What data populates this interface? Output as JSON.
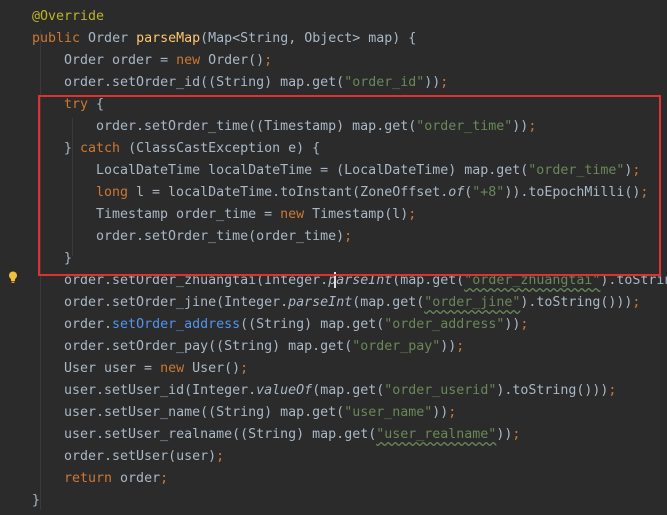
{
  "code_lines": [
    {
      "indent": 0,
      "tokens": [
        {
          "t": "@Override",
          "c": "ann"
        }
      ]
    },
    {
      "indent": 0,
      "tokens": [
        {
          "t": "public ",
          "c": "kw"
        },
        {
          "t": "Order "
        },
        {
          "t": "parseMap",
          "c": "fn"
        },
        {
          "t": "(Map<String, Object> map) {"
        }
      ]
    },
    {
      "indent": 1,
      "tokens": [
        {
          "t": "Order order = "
        },
        {
          "t": "new ",
          "c": "kw"
        },
        {
          "t": "Order()"
        },
        {
          "t": ";",
          "c": "kw"
        }
      ]
    },
    {
      "indent": 1,
      "tokens": [
        {
          "t": "order.setOrder_id((String) map.get("
        },
        {
          "t": "\"order_id\"",
          "c": "str"
        },
        {
          "t": "))"
        },
        {
          "t": ";",
          "c": "kw"
        }
      ]
    },
    {
      "indent": 1,
      "tokens": [
        {
          "t": "try ",
          "c": "kw"
        },
        {
          "t": "{"
        }
      ]
    },
    {
      "indent": 2,
      "tokens": [
        {
          "t": "order.setOrder_time((Timestamp) map.get("
        },
        {
          "t": "\"order_time\"",
          "c": "str"
        },
        {
          "t": "))"
        },
        {
          "t": ";",
          "c": "kw"
        }
      ]
    },
    {
      "indent": 1,
      "tokens": [
        {
          "t": "} "
        },
        {
          "t": "catch ",
          "c": "kw"
        },
        {
          "t": "(ClassCastException e) {"
        }
      ]
    },
    {
      "indent": 2,
      "tokens": [
        {
          "t": "LocalDateTime localDateTime = (LocalDateTime) map.get("
        },
        {
          "t": "\"order_time\"",
          "c": "str"
        },
        {
          "t": ")"
        },
        {
          "t": ";",
          "c": "kw"
        }
      ]
    },
    {
      "indent": 2,
      "tokens": [
        {
          "t": "long ",
          "c": "kw"
        },
        {
          "t": "l = localDateTime.toInstant(ZoneOffset."
        },
        {
          "t": "of",
          "c": "it"
        },
        {
          "t": "("
        },
        {
          "t": "\"+8\"",
          "c": "str"
        },
        {
          "t": ")).toEpochMilli()"
        },
        {
          "t": ";",
          "c": "kw"
        }
      ]
    },
    {
      "indent": 2,
      "tokens": [
        {
          "t": "Timestamp order_time = "
        },
        {
          "t": "new ",
          "c": "kw"
        },
        {
          "t": "Timestamp(l)"
        },
        {
          "t": ";",
          "c": "kw"
        }
      ]
    },
    {
      "indent": 2,
      "tokens": [
        {
          "t": "order.setOrder_time(order_time)"
        },
        {
          "t": ";",
          "c": "kw"
        }
      ]
    },
    {
      "indent": 1,
      "tokens": [
        {
          "t": "}"
        }
      ]
    },
    {
      "indent": 1,
      "tokens": [
        {
          "t": "order.setOrder_zhuangtai(Integer."
        },
        {
          "t": "parseInt",
          "c": "it"
        },
        {
          "t": "(map.get("
        },
        {
          "t": "\"order_zhuangtai\"",
          "c": "str squig"
        },
        {
          "t": ").toString()))"
        },
        {
          "t": ";",
          "c": "kw"
        }
      ]
    },
    {
      "indent": 1,
      "tokens": [
        {
          "t": "order.setOrder_jine(Integer."
        },
        {
          "t": "parseInt",
          "c": "it"
        },
        {
          "t": "(map.get("
        },
        {
          "t": "\"order_jine\"",
          "c": "str squig"
        },
        {
          "t": ").toString()))"
        },
        {
          "t": ";",
          "c": "kw"
        }
      ]
    },
    {
      "indent": 1,
      "tokens": [
        {
          "t": "order."
        },
        {
          "t": "setOrder_address",
          "c": "blu"
        },
        {
          "t": "((String) map.get("
        },
        {
          "t": "\"order_address\"",
          "c": "str"
        },
        {
          "t": "))"
        },
        {
          "t": ";",
          "c": "kw"
        }
      ]
    },
    {
      "indent": 1,
      "tokens": [
        {
          "t": "order.setOrder_pay((String) map.get("
        },
        {
          "t": "\"order_pay\"",
          "c": "str"
        },
        {
          "t": "))"
        },
        {
          "t": ";",
          "c": "kw"
        }
      ]
    },
    {
      "indent": 1,
      "tokens": [
        {
          "t": "User user = "
        },
        {
          "t": "new ",
          "c": "kw"
        },
        {
          "t": "User()"
        },
        {
          "t": ";",
          "c": "kw"
        }
      ]
    },
    {
      "indent": 1,
      "tokens": [
        {
          "t": "user.setUser_id(Integer."
        },
        {
          "t": "valueOf",
          "c": "it"
        },
        {
          "t": "(map.get("
        },
        {
          "t": "\"order_userid\"",
          "c": "str"
        },
        {
          "t": ").toString()))"
        },
        {
          "t": ";",
          "c": "kw"
        }
      ]
    },
    {
      "indent": 1,
      "tokens": [
        {
          "t": "user.setUser_name((String) map.get("
        },
        {
          "t": "\"user_name\"",
          "c": "str"
        },
        {
          "t": "))"
        },
        {
          "t": ";",
          "c": "kw"
        }
      ]
    },
    {
      "indent": 1,
      "tokens": [
        {
          "t": "user.setUser_realname((String) map.get("
        },
        {
          "t": "\"user_realname\"",
          "c": "str squig"
        },
        {
          "t": "))"
        },
        {
          "t": ";",
          "c": "kw"
        }
      ]
    },
    {
      "indent": 1,
      "tokens": [
        {
          "t": "order.setUser(user)"
        },
        {
          "t": ";",
          "c": "kw"
        }
      ]
    },
    {
      "indent": 1,
      "tokens": [
        {
          "t": "return ",
          "c": "kw"
        },
        {
          "t": "order"
        },
        {
          "t": ";",
          "c": "kw"
        }
      ]
    },
    {
      "indent": 0,
      "tokens": [
        {
          "t": "}"
        }
      ]
    }
  ],
  "colors": {
    "background": "#2b2b2b",
    "text": "#a9b7c6",
    "keyword": "#cc7832",
    "annotation": "#bbb529",
    "string": "#6a8759",
    "method_declaration": "#ffc66d",
    "highlight_box": "#e03030"
  },
  "icons": {
    "gutter_hint": "lightbulb-icon"
  }
}
